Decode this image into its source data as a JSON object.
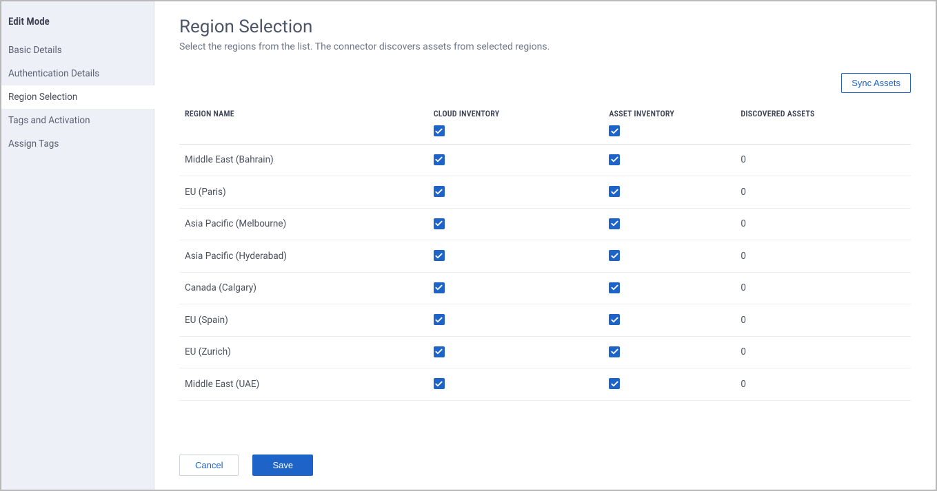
{
  "sidebar": {
    "title": "Edit Mode",
    "items": [
      {
        "label": "Basic Details",
        "active": false
      },
      {
        "label": "Authentication Details",
        "active": false
      },
      {
        "label": "Region Selection",
        "active": true
      },
      {
        "label": "Tags and Activation",
        "active": false
      },
      {
        "label": "Assign Tags",
        "active": false
      }
    ]
  },
  "main": {
    "title": "Region Selection",
    "subtitle": "Select the regions from the list. The connector discovers assets from selected regions."
  },
  "toolbar": {
    "sync_label": "Sync Assets"
  },
  "table": {
    "headers": {
      "region": "REGION NAME",
      "cloud": "CLOUD INVENTORY",
      "asset": "ASSET INVENTORY",
      "discovered": "DISCOVERED ASSETS"
    },
    "select_all": {
      "cloud": true,
      "asset": true
    },
    "rows": [
      {
        "region": "Middle East (Bahrain)",
        "cloud": true,
        "asset": true,
        "discovered": "0"
      },
      {
        "region": "EU (Paris)",
        "cloud": true,
        "asset": true,
        "discovered": "0"
      },
      {
        "region": "Asia Pacific (Melbourne)",
        "cloud": true,
        "asset": true,
        "discovered": "0"
      },
      {
        "region": "Asia Pacific (Hyderabad)",
        "cloud": true,
        "asset": true,
        "discovered": "0"
      },
      {
        "region": "Canada (Calgary)",
        "cloud": true,
        "asset": true,
        "discovered": "0"
      },
      {
        "region": "EU (Spain)",
        "cloud": true,
        "asset": true,
        "discovered": "0"
      },
      {
        "region": "EU (Zurich)",
        "cloud": true,
        "asset": true,
        "discovered": "0"
      },
      {
        "region": "Middle East (UAE)",
        "cloud": true,
        "asset": true,
        "discovered": "0"
      }
    ]
  },
  "footer": {
    "cancel_label": "Cancel",
    "save_label": "Save"
  }
}
